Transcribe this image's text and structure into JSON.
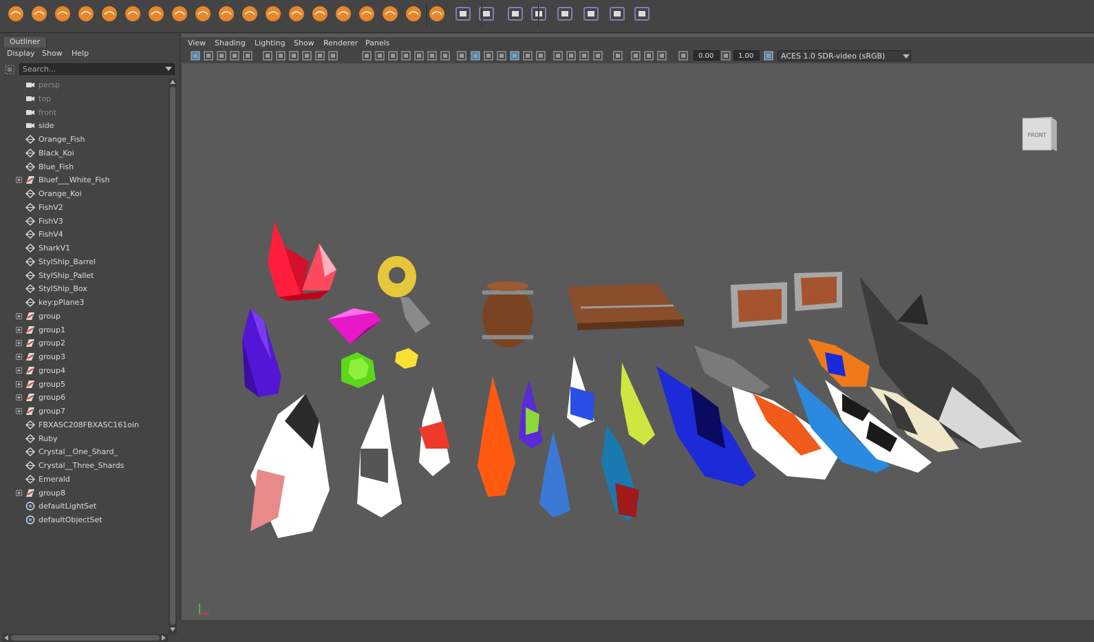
{
  "outliner": {
    "tab_title": "Outliner",
    "menus": [
      "Display",
      "Show",
      "Help"
    ],
    "search_placeholder": "Search...",
    "items": [
      {
        "label": "persp",
        "icon": "camera-icon",
        "expandable": false,
        "dim": true
      },
      {
        "label": "top",
        "icon": "camera-icon",
        "expandable": false,
        "dim": true
      },
      {
        "label": "front",
        "icon": "camera-icon",
        "expandable": false,
        "dim": true
      },
      {
        "label": "side",
        "icon": "camera-icon",
        "expandable": false,
        "dim": false
      },
      {
        "label": "Orange_Fish",
        "icon": "mesh-icon",
        "expandable": false,
        "dim": false
      },
      {
        "label": "Black_Koi",
        "icon": "mesh-icon",
        "expandable": false,
        "dim": false
      },
      {
        "label": "Blue_Fish",
        "icon": "mesh-icon",
        "expandable": false,
        "dim": false
      },
      {
        "label": "Bluef___White_Fish",
        "icon": "group-icon",
        "expandable": true,
        "dim": false
      },
      {
        "label": "Orange_Koi",
        "icon": "mesh-icon",
        "expandable": false,
        "dim": false
      },
      {
        "label": "FishV2",
        "icon": "mesh-icon",
        "expandable": false,
        "dim": false
      },
      {
        "label": "FishV3",
        "icon": "mesh-icon",
        "expandable": false,
        "dim": false
      },
      {
        "label": "FishV4",
        "icon": "mesh-icon",
        "expandable": false,
        "dim": false
      },
      {
        "label": "SharkV1",
        "icon": "mesh-icon",
        "expandable": false,
        "dim": false
      },
      {
        "label": "StylShip_Barrel",
        "icon": "mesh-icon",
        "expandable": false,
        "dim": false
      },
      {
        "label": "StylShip_Pallet",
        "icon": "mesh-icon",
        "expandable": false,
        "dim": false
      },
      {
        "label": "StylShip_Box",
        "icon": "mesh-icon",
        "expandable": false,
        "dim": false
      },
      {
        "label": "key:pPlane3",
        "icon": "mesh-icon",
        "expandable": false,
        "dim": false
      },
      {
        "label": "group",
        "icon": "group-icon",
        "expandable": true,
        "dim": false
      },
      {
        "label": "group1",
        "icon": "group-icon",
        "expandable": true,
        "dim": false
      },
      {
        "label": "group2",
        "icon": "group-icon",
        "expandable": true,
        "dim": false
      },
      {
        "label": "group3",
        "icon": "group-icon",
        "expandable": true,
        "dim": false
      },
      {
        "label": "group4",
        "icon": "group-icon",
        "expandable": true,
        "dim": false
      },
      {
        "label": "group5",
        "icon": "group-icon",
        "expandable": true,
        "dim": false
      },
      {
        "label": "group6",
        "icon": "group-icon",
        "expandable": true,
        "dim": false
      },
      {
        "label": "group7",
        "icon": "group-icon",
        "expandable": true,
        "dim": false
      },
      {
        "label": "FBXASC208FBXASC161oin",
        "icon": "mesh-icon",
        "expandable": false,
        "dim": false
      },
      {
        "label": "Ruby",
        "icon": "mesh-icon",
        "expandable": false,
        "dim": false
      },
      {
        "label": "Crystal__One_Shard_",
        "icon": "mesh-icon",
        "expandable": false,
        "dim": false
      },
      {
        "label": "Crystal__Three_Shards",
        "icon": "mesh-icon",
        "expandable": false,
        "dim": false
      },
      {
        "label": "Emerald",
        "icon": "mesh-icon",
        "expandable": false,
        "dim": false
      },
      {
        "label": "group8",
        "icon": "group-icon",
        "expandable": true,
        "dim": false
      },
      {
        "label": "defaultLightSet",
        "icon": "set-icon",
        "expandable": false,
        "dim": false
      },
      {
        "label": "defaultObjectSet",
        "icon": "set-icon",
        "expandable": false,
        "dim": false
      }
    ]
  },
  "panel": {
    "menus": [
      "View",
      "Shading",
      "Lighting",
      "Show",
      "Renderer",
      "Panels"
    ],
    "exposure_value": "0.00",
    "gamma_value": "1.00",
    "color_space": "ACES 1.0 SDR-video (sRGB)",
    "view_cube_label": "FRONT"
  },
  "colors": {
    "shelf_icon_orange": "#e8872a",
    "shelf_icon_purple": "#8a7ab5",
    "viewport_bg": "#5a5a5a",
    "panel_bg": "#444444",
    "selected_button": "#3d82b7"
  },
  "shelf": {
    "icons": [
      "sphere-icon",
      "cube-icon",
      "cylinder-icon",
      "cone-icon",
      "torus-icon",
      "plane-icon",
      "disc-icon",
      "platonic-icon",
      "pyramid-icon",
      "prism-icon",
      "pipe-icon",
      "helix-icon",
      "gear-icon",
      "soccer-ball-icon",
      "superellipse-icon",
      "sphere-cone-icon",
      "spike-icon",
      "svg-icon",
      "sun-icon",
      "snowflake-icon",
      "grid-icon",
      "camera-view-icon",
      "person-icon",
      "uv-icon",
      "uv-layout-icon",
      "wireframe-icon",
      "eraser-icon"
    ]
  },
  "scene_objects": [
    "Crystal__Three_Shards",
    "Crystal__One_Shard_",
    "Ruby",
    "Emerald",
    "coin",
    "key",
    "StylShip_Barrel",
    "StylShip_Pallet",
    "StylShip_Box",
    "SharkV1",
    "fish_models"
  ]
}
